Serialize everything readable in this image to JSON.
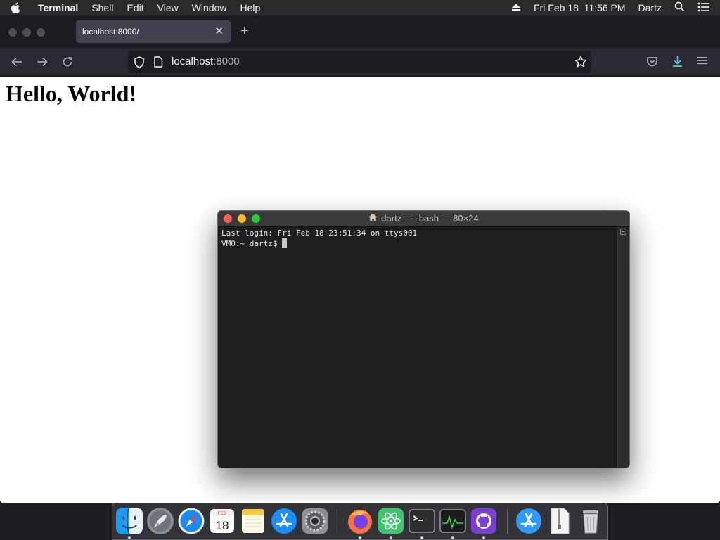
{
  "menubar": {
    "app_name": "Terminal",
    "items": [
      "Shell",
      "Edit",
      "View",
      "Window",
      "Help"
    ],
    "date": "Fri Feb 18",
    "time": "11:56 PM",
    "user": "Dartz"
  },
  "browser": {
    "tab_title": "localhost:8000/",
    "url_host": "localhost",
    "url_port": ":8000",
    "page_heading": "Hello, World!"
  },
  "terminal": {
    "title": "dartz — -bash — 80×24",
    "last_login": "Last login: Fri Feb 18 23:51:34 on ttys001",
    "prompt": "VM0:~ dartz$ "
  },
  "dock": {
    "apps": [
      "finder-icon",
      "launchpad-icon",
      "safari-icon",
      "calendar-icon",
      "notes-icon",
      "app-store-icon",
      "system-preferences-icon",
      "firefox-icon",
      "atom-icon",
      "terminal-icon",
      "activity-monitor-icon",
      "github-desktop-icon",
      "downloads-app-store-icon",
      "archive-file-icon",
      "trash-icon"
    ],
    "calendar_month": "FEB",
    "calendar_day": "18"
  },
  "colors": {
    "menubar": "#2a2a2c",
    "browser_chrome": "#2b2a33",
    "terminal_bg": "#1e1e1e",
    "accent_download": "#54ffbd"
  }
}
